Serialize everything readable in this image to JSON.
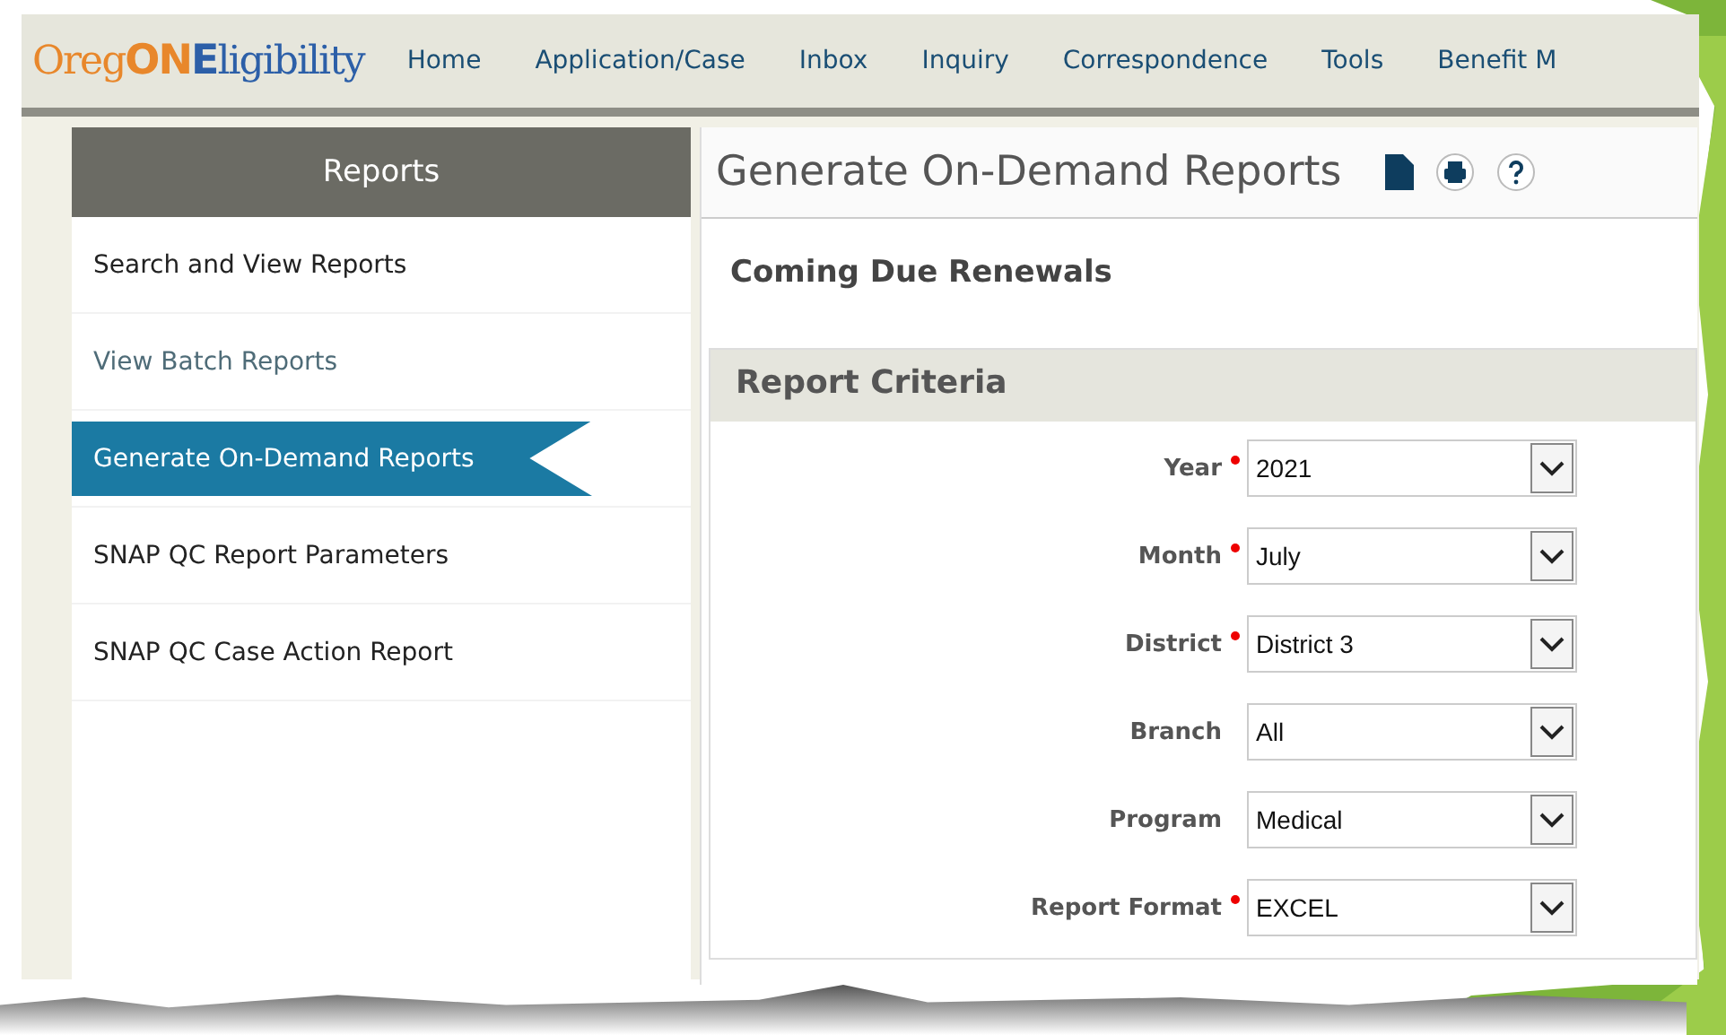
{
  "logo": [
    {
      "text": "Oreg",
      "color": "#e8872b",
      "bold": false
    },
    {
      "text": "ON",
      "color": "#e8872b",
      "bold": true
    },
    {
      "text": "E",
      "color": "#2c5fa8",
      "bold": true
    },
    {
      "text": "ligibility",
      "color": "#2c5fa8",
      "bold": false
    }
  ],
  "nav": [
    "Home",
    "Application/Case",
    "Inbox",
    "Inquiry",
    "Correspondence",
    "Tools",
    "Benefit M"
  ],
  "sidebar": {
    "title": "Reports",
    "items": [
      {
        "label": "Search and View Reports",
        "selected": false,
        "visited": false
      },
      {
        "label": "View Batch Reports",
        "selected": false,
        "visited": true
      },
      {
        "label": "Generate On-Demand Reports",
        "selected": true,
        "visited": false
      },
      {
        "label": "SNAP QC Report Parameters",
        "selected": false,
        "visited": false
      },
      {
        "label": "SNAP QC Case Action Report",
        "selected": false,
        "visited": false
      }
    ]
  },
  "page_title": "Generate On-Demand Reports",
  "report_name": "Coming Due Renewals",
  "criteria": {
    "title": "Report Criteria",
    "fields": [
      {
        "label": "Year",
        "required": true,
        "value": "2021"
      },
      {
        "label": "Month",
        "required": true,
        "value": "July"
      },
      {
        "label": "District",
        "required": true,
        "value": "District 3"
      },
      {
        "label": "Branch",
        "required": false,
        "value": "All"
      },
      {
        "label": "Program",
        "required": false,
        "value": "Medical"
      },
      {
        "label": "Report Format",
        "required": true,
        "value": "EXCEL"
      }
    ]
  }
}
